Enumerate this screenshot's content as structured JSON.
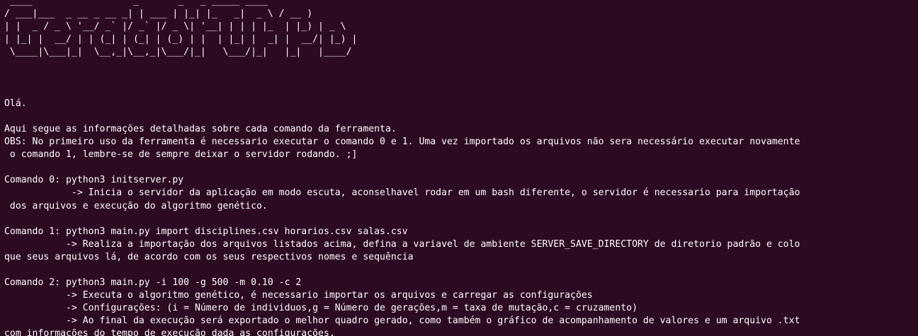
{
  "terminal": {
    "banner": [
      " ____                  _       _   _ _____ ____  ",
      "/ ___|___  _ __ _ __ _| | ___ | |_| |_   _|  _ \\ / __ )",
      "| |  _ / _ \\ '__/ _` |/ _` |/ _ \\| '__| | | | |_  | |_) | _ \\",
      "| |_| |  __/ | | (_| | (_| | (_) | |  | |_| |  _| |  __/| |_) |",
      " \\____|\\___|_|  \\__,_|\\__,_|\\___/|_|   \\___/|_|   |_|   |____/"
    ],
    "lines": [
      "",
      "",
      "",
      "Olá.",
      "",
      "Aqui segue as informações detalhadas sobre cada comando da ferramenta.",
      "OBS: No primeiro uso da ferramenta é necessario executar o comando 0 e 1. Uma vez importado os arquivos não sera necessário executar novamente",
      " o comando 1, lembre-se de sempre deixar o servidor rodando. ;]",
      "",
      "Comando 0: python3 initserver.py",
      "            -> Inicia o servidor da aplicação em modo escuta, aconselhavel rodar em um bash diferente, o servidor é necessario para importação",
      " dos arquivos e execução do algoritmo genético.",
      "",
      "Comando 1: python3 main.py import disciplines.csv horarios.csv salas.csv",
      "           -> Realiza a importação dos arquivos listados acima, defina a variavel de ambiente SERVER_SAVE_DIRECTORY de diretorio padrão e colo",
      "que seus arquivos lá, de acordo com os seus respectivos nomes e sequência",
      "",
      "Comando 2: python3 main.py -i 100 -g 500 -m 0.10 -c 2",
      "           -> Executa o algoritmo genético, é necessario importar os arquivos e carregar as configurações",
      "           -> Configurações: (i = Número de individuos,g = Número de gerações,m = taxa de mutação,c = cruzamento)",
      "           -> Ao final da execução será exportado o melhor quadro gerado, como também o gráfico de acompanhamento de valores e um arquivo .txt",
      "com informações do tempo de execução dada as configurações."
    ]
  }
}
